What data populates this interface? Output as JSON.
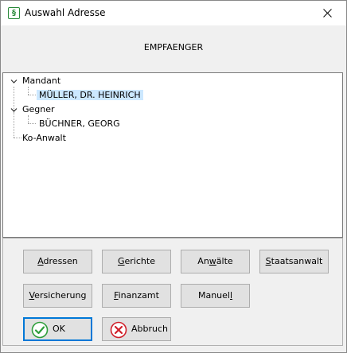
{
  "window": {
    "title": "Auswahl Adresse",
    "icon": "paragraph-icon",
    "icon_glyph": "§"
  },
  "header": {
    "label": "EMPFAENGER"
  },
  "tree": {
    "groups": [
      {
        "label": "Mandant",
        "expanded": true,
        "children": [
          "MÜLLER, DR. HEINRICH"
        ],
        "selected_child": 0
      },
      {
        "label": "Gegner",
        "expanded": true,
        "children": [
          "BÜCHNER, GEORG"
        ]
      },
      {
        "label": "Ko-Anwalt",
        "expanded": false,
        "children": []
      }
    ]
  },
  "buttons": {
    "adressen": {
      "pre": "",
      "accel": "A",
      "post": "dressen"
    },
    "gerichte": {
      "pre": "",
      "accel": "G",
      "post": "erichte"
    },
    "anwaelte": {
      "pre": "An",
      "accel": "w",
      "post": "älte"
    },
    "staatsanwalt": {
      "pre": "",
      "accel": "S",
      "post": "taatsanwalt"
    },
    "versicherung": {
      "pre": "",
      "accel": "V",
      "post": "ersicherung"
    },
    "finanzamt": {
      "pre": "",
      "accel": "F",
      "post": "inanzamt"
    },
    "manuell": {
      "pre": "Manuel",
      "accel": "l",
      "post": ""
    },
    "ok": "OK",
    "abbruch": "Abbruch"
  },
  "colors": {
    "selection": "#cce8ff",
    "ok_border": "#0078d7",
    "ok_icon": "#2e9e3a",
    "cancel_icon": "#d0202a"
  }
}
